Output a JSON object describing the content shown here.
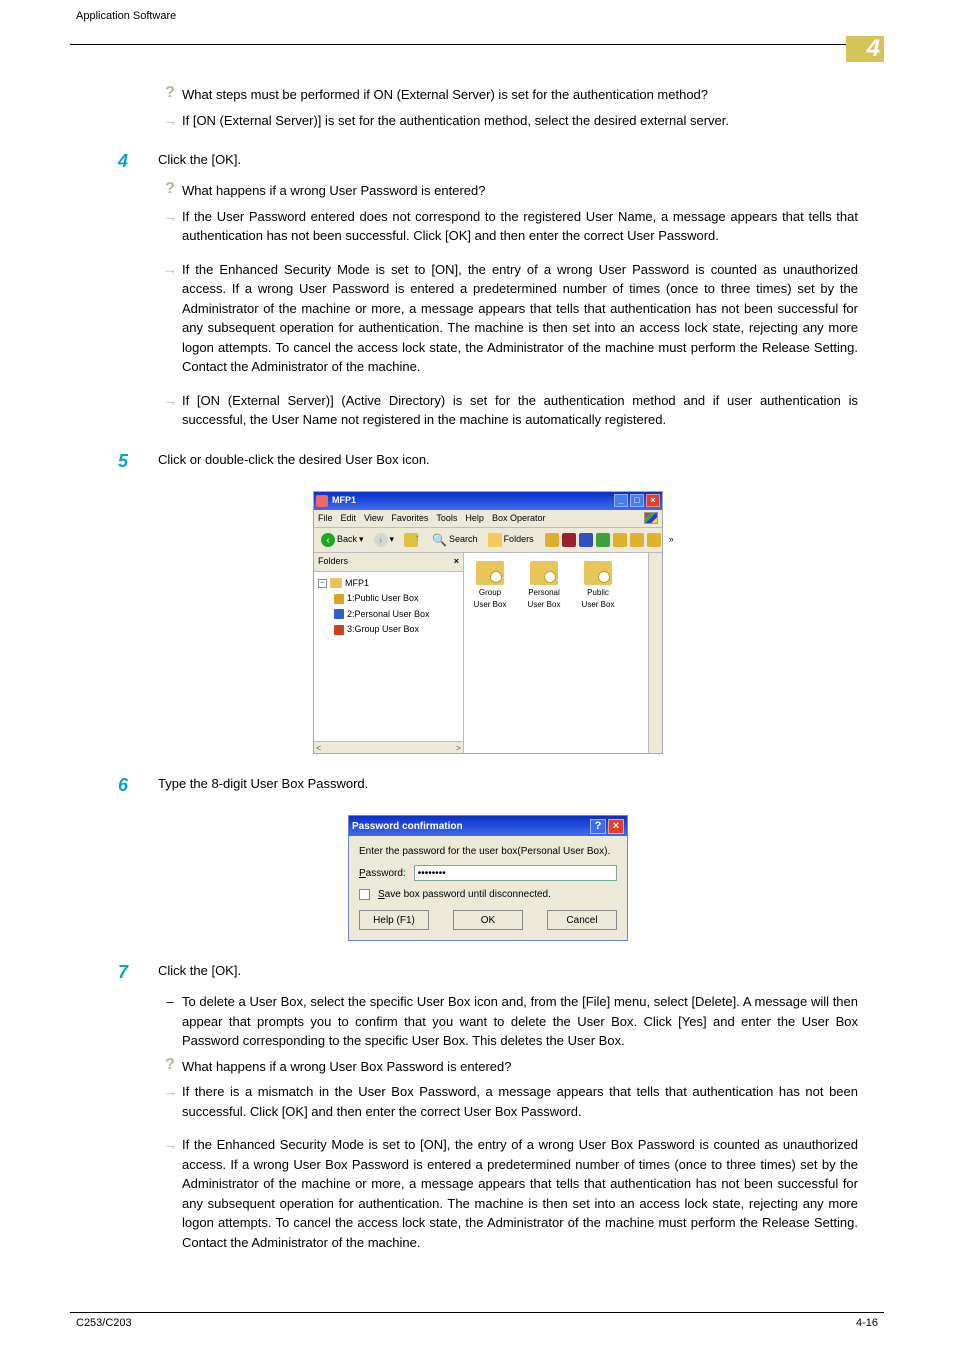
{
  "header": {
    "title": "Application Software"
  },
  "chapter_badge": "4",
  "blocks": {
    "b1_q": "What steps must be performed if ON (External Server) is set for the authentication method?",
    "b1_a": "If [ON (External Server)] is set for the authentication method, select the desired external server.",
    "step4_text": "Click the [OK].",
    "s4_q": "What happens if a wrong User Password is entered?",
    "s4_a1": "If the User Password entered does not correspond to the registered User Name, a message appears that tells that authentication has not been successful. Click [OK] and then enter the correct User Password.",
    "s4_a2": "If the Enhanced Security Mode is set to [ON], the entry of a wrong User Password is counted as unauthorized access. If a wrong User Password is entered a predetermined number of times (once to three times) set by the Administrator of the machine or more, a message appears that tells that authentication has not been successful for any subsequent operation for authentication. The machine is then set into an access lock state, rejecting any more logon attempts. To cancel the access lock state, the Administrator of the machine must perform the Release Setting. Contact the Administrator of the machine.",
    "s4_a3": "If [ON (External Server)] (Active Directory) is set for the authentication method and if user authentication is successful, the User Name not registered in the machine is automatically registered.",
    "step5_text": "Click or double-click the desired User Box icon.",
    "step6_text": "Type the 8-digit User Box Password.",
    "step7_text": "Click the [OK].",
    "s7_d": "To delete a User Box, select the specific User Box icon and, from the [File] menu, select [Delete]. A message will then appear that prompts you to confirm that you want to delete the User Box. Click [Yes] and enter the User Box Password corresponding to the specific User Box. This deletes the User Box.",
    "s7_q": "What happens if a wrong User Box Password is entered?",
    "s7_a1": "If there is a mismatch in the User Box Password, a message appears that tells that authentication has not been successful. Click [OK] and then enter the correct User Box Password.",
    "s7_a2": "If the Enhanced Security Mode is set to [ON], the entry of a wrong User Box Password is counted as unauthorized access. If a wrong User Box Password is entered a predetermined number of times (once to three times) set by the Administrator of the machine or more, a message appears that tells that authentication has not been successful for any subsequent operation for authentication. The machine is then set into an access lock state, rejecting any more logon attempts. To cancel the access lock state, the Administrator of the machine must perform the Release Setting. Contact the Administrator of the machine."
  },
  "step_numbers": {
    "s4": "4",
    "s5": "5",
    "s6": "6",
    "s7": "7"
  },
  "sshot1": {
    "title": "MFP1",
    "menu": [
      "File",
      "Edit",
      "View",
      "Favorites",
      "Tools",
      "Help",
      "Box Operator"
    ],
    "back": "Back",
    "search": "Search",
    "folders_btn": "Folders",
    "pane_header": "Folders",
    "root": "MFP1",
    "tree": [
      "1:Public User Box",
      "2:Personal User Box",
      "3:Group User Box"
    ],
    "boxes": [
      "Group User Box",
      "Personal User Box",
      "Public User Box"
    ]
  },
  "sshot2": {
    "title": "Password confirmation",
    "prompt": "Enter the password for the user box(Personal User Box).",
    "pw_label": "Password:",
    "pw_value": "••••••••",
    "cb_label": "Save box password until disconnected.",
    "help": "Help (F1)",
    "ok": "OK",
    "cancel": "Cancel"
  },
  "footer": {
    "left": "C253/C203",
    "right": "4-16"
  }
}
